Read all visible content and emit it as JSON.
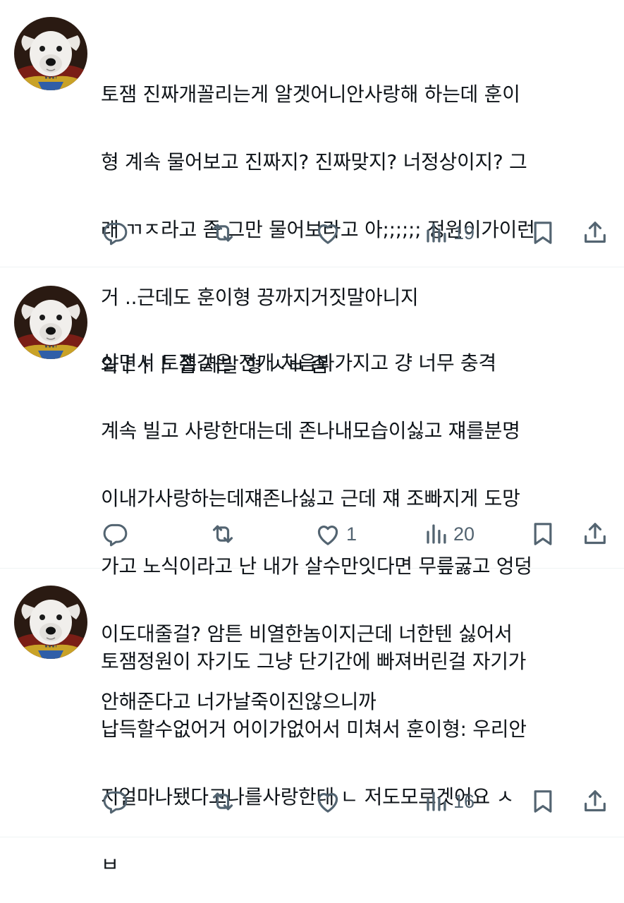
{
  "posts": [
    {
      "lines": [
        "토잼 진짜개꼴리는게 알겟어니안사랑해 하는데 훈이",
        "형 계속 물어보고 진짜지? 진짜맞지? 너정상이지? 그",
        "래 ㄲㅈ라고 좀 그만 물어보라고 아;;;;;; 정원이가이런",
        "거 ..근데도 훈이형 끙까지거짓말아니지",
        "와ㅏㅏㅏ 좀 제발 형 ㅅㅂ 좀"
      ],
      "actions": {
        "reply": "",
        "repost": "",
        "like": "",
        "views": "19"
      }
    },
    {
      "lines": [
        "살면서 토잼같은 전개 처음봐가지고 걍 너무 충격",
        "계속 빌고 사랑한대는데 존나내모습이싫고 쟤를분명",
        "이내가사랑하는데쟤존나싫고 근데 쟤 조빠지게 도망",
        "가고 노식이라고 난 내가 살수만잇다면 무릎굻고 엉덩",
        "이도대줄걸? 암튼 비열한놈이지근데 너한텐 싫어서",
        "안해준다고 너가날죽이진않으니까"
      ],
      "actions": {
        "reply": "",
        "repost": "",
        "like": "1",
        "views": "20"
      }
    },
    {
      "lines": [
        "토잼정원이 자기도 그냥 단기간에 빠져버린걸 자기가",
        "납득할수없어거 어이가없어서 미쳐서 훈이형: 우리안",
        "지얼마나됐다고나를사랑한대 ㄴ 저도모르겟어요 ㅅ",
        "ㅂ"
      ],
      "actions": {
        "reply": "",
        "repost": "",
        "like": "",
        "views": "16"
      }
    }
  ],
  "icons": {
    "reply": "reply-icon",
    "repost": "repost-icon",
    "like": "like-icon",
    "views": "views-icon",
    "bookmark": "bookmark-icon",
    "share": "share-icon"
  },
  "colors": {
    "text": "#0f1419",
    "muted": "#536471",
    "divider": "#eff3f4"
  }
}
